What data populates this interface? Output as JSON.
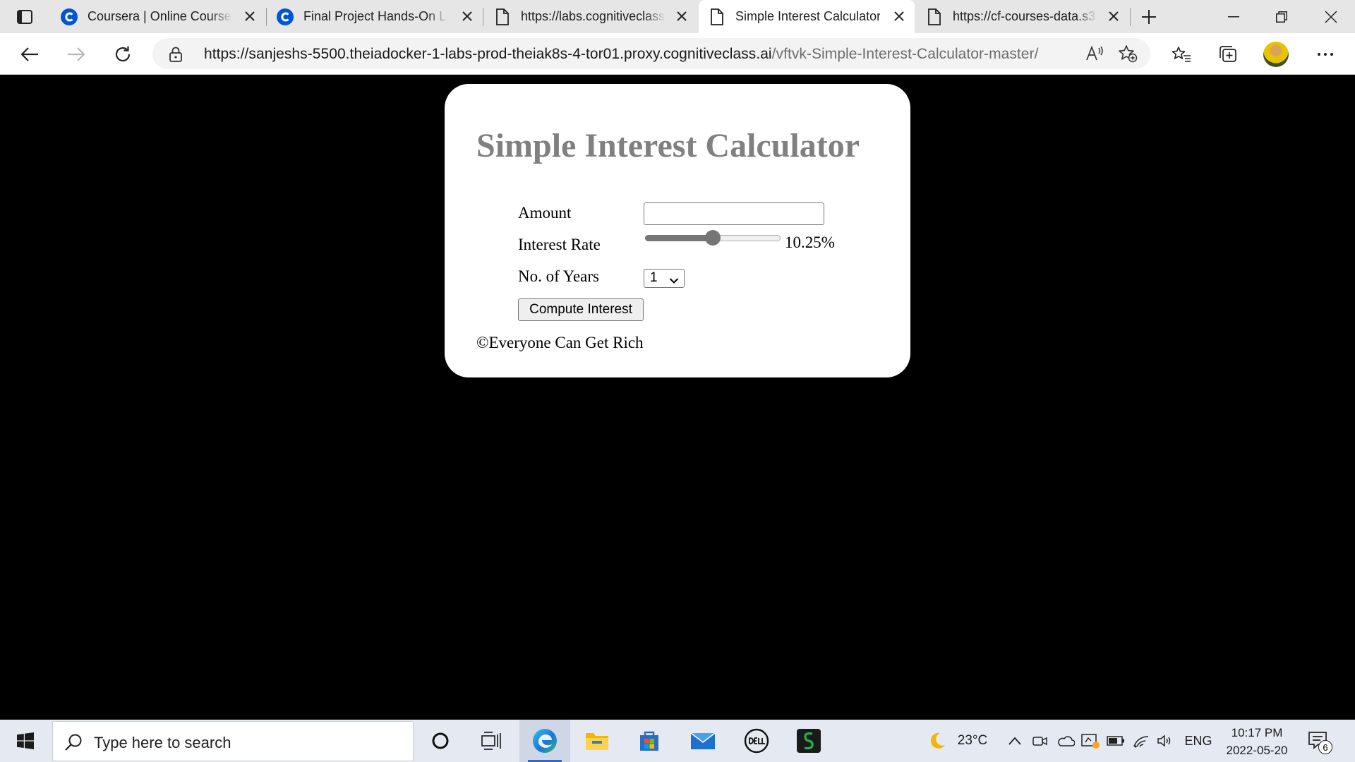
{
  "browser": {
    "tabs": [
      {
        "title": "Coursera | Online Courses & Credentials From Top Educators",
        "icon": "coursera-icon"
      },
      {
        "title": "Final Project Hands-On Lab",
        "icon": "coursera-icon"
      },
      {
        "title": "https://labs.cognitiveclass.ai",
        "icon": "page-icon"
      },
      {
        "title": "Simple Interest Calculator",
        "icon": "page-icon"
      },
      {
        "title": "https://cf-courses-data.s3",
        "icon": "page-icon"
      }
    ],
    "url": {
      "host": "https://sanjeshs-5500.theiadocker-1-labs-prod-theiak8s-4-tor01.proxy.cognitiveclass.ai",
      "path": "/vftvk-Simple-Interest-Calculator-master/"
    }
  },
  "page": {
    "title": "Simple Interest Calculator",
    "amount_label": "Amount",
    "amount_value": "",
    "rate_label": "Interest Rate",
    "rate_display": "10.25%",
    "rate_fraction": 0.5,
    "years_label": "No. of Years",
    "years_value": "1",
    "compute_label": "Compute Interest",
    "footer": "©Everyone Can Get Rich"
  },
  "taskbar": {
    "search_placeholder": "Type here to search",
    "temperature": "23°C",
    "language": "ENG",
    "time": "10:17 PM",
    "date": "2022-05-20",
    "notification_count": "6"
  },
  "colors": {
    "title_gray": "#808080",
    "edge_blue": "#1e74d3",
    "coursera_blue": "#0056d2"
  }
}
